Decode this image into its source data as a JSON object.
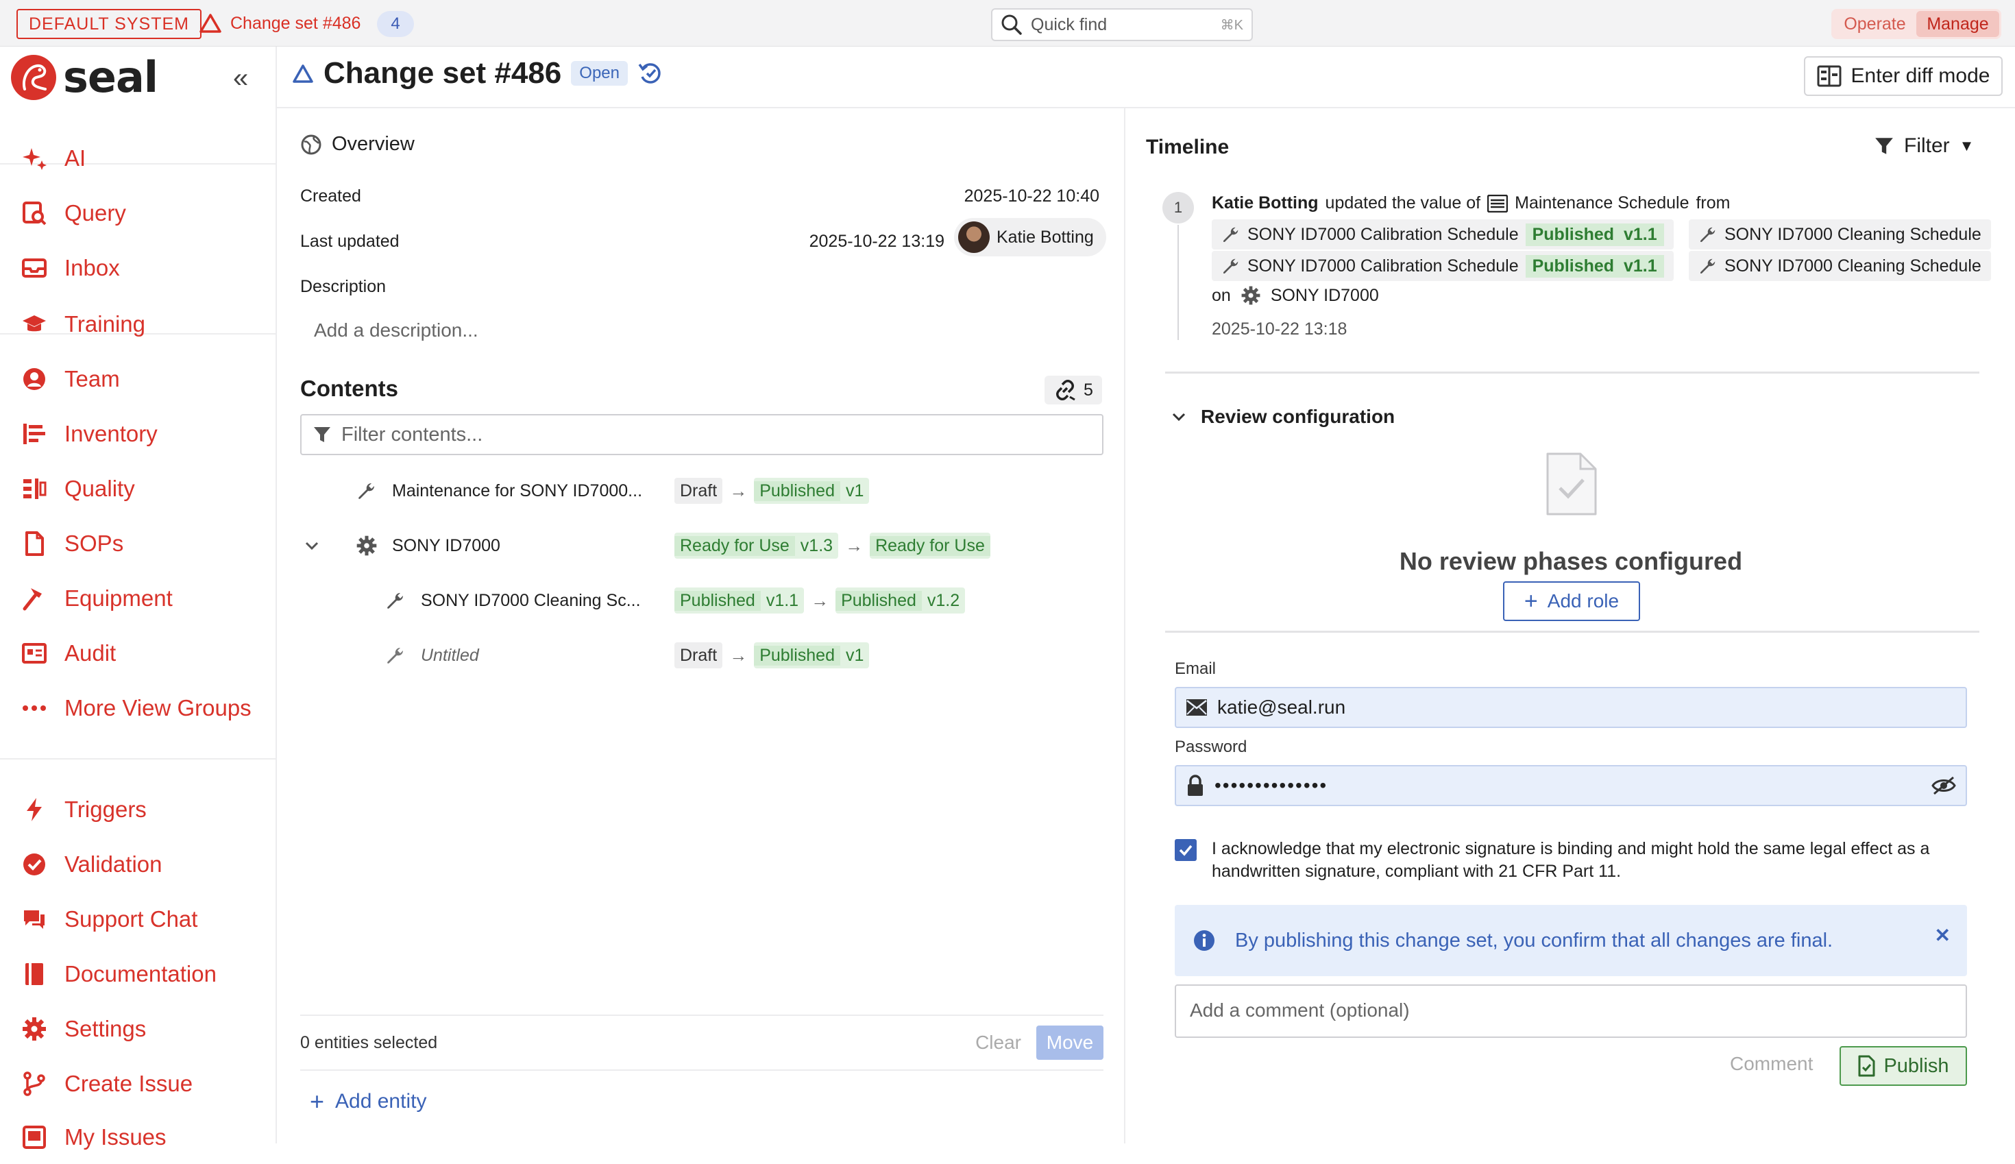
{
  "topbar": {
    "system_badge": "DEFAULT SYSTEM",
    "changeset_label": "Change set #486",
    "changeset_count": "4",
    "quick_find_placeholder": "Quick find",
    "quick_find_shortcut": "⌘K",
    "modes": [
      "Operate",
      "Manage"
    ],
    "active_mode": "Manage"
  },
  "sidebar": {
    "logo_text": "seal",
    "items": [
      {
        "label": "AI",
        "icon": "sparkles-icon"
      },
      {
        "label": "Query",
        "icon": "query-icon"
      },
      {
        "label": "Inbox",
        "icon": "inbox-icon"
      },
      {
        "label": "Training",
        "icon": "graduation-cap-icon"
      },
      {
        "label": "Team",
        "icon": "user-icon"
      },
      {
        "label": "Inventory",
        "icon": "inventory-icon"
      },
      {
        "label": "Quality",
        "icon": "quality-icon"
      },
      {
        "label": "SOPs",
        "icon": "document-icon"
      },
      {
        "label": "Equipment",
        "icon": "hammer-icon"
      },
      {
        "label": "Audit",
        "icon": "audit-icon"
      },
      {
        "label": "More View Groups",
        "icon": "more-icon"
      },
      {
        "label": "Triggers",
        "icon": "lightning-icon"
      },
      {
        "label": "Validation",
        "icon": "check-badge-icon"
      },
      {
        "label": "Support Chat",
        "icon": "chat-icon"
      },
      {
        "label": "Documentation",
        "icon": "book-icon"
      },
      {
        "label": "Settings",
        "icon": "gear-icon"
      },
      {
        "label": "Create Issue",
        "icon": "branch-icon"
      },
      {
        "label": "My Issues",
        "icon": "issues-icon"
      }
    ]
  },
  "header": {
    "title": "Change set #486",
    "status": "Open",
    "diff_button": "Enter diff mode"
  },
  "overview": {
    "heading": "Overview",
    "created_label": "Created",
    "created_value": "2025-10-22 10:40",
    "updated_label": "Last updated",
    "updated_value": "2025-10-22 13:19",
    "updated_by": "Katie Botting",
    "description_label": "Description",
    "description_placeholder": "Add a description..."
  },
  "contents": {
    "heading": "Contents",
    "link_count": "5",
    "filter_placeholder": "Filter contents...",
    "rows": [
      {
        "name": "Maintenance for SONY ID7000...",
        "from_status": "Draft",
        "from_version": "",
        "to_status": "Published",
        "to_version": "v1"
      },
      {
        "name": "SONY ID7000",
        "from_status": "Ready for Use",
        "from_version": "v1.3",
        "to_status": "Ready for Use",
        "to_version": ""
      },
      {
        "name": "SONY ID7000 Cleaning Sc...",
        "from_status": "Published",
        "from_version": "v1.1",
        "to_status": "Published",
        "to_version": "v1.2"
      },
      {
        "name": "Untitled",
        "from_status": "Draft",
        "from_version": "",
        "to_status": "Published",
        "to_version": "v1"
      }
    ],
    "selected_text": "0 entities selected",
    "clear_label": "Clear",
    "move_label": "Move",
    "add_entity_label": "Add entity"
  },
  "timeline": {
    "heading": "Timeline",
    "filter_label": "Filter",
    "entry": {
      "number": "1",
      "actor": "Katie Botting",
      "action": "updated the value of",
      "field": "Maintenance Schedule",
      "from_word": "from",
      "refs": [
        {
          "name": "SONY ID7000 Calibration Schedule",
          "status": "Published",
          "version": "v1.1"
        },
        {
          "name": "SONY ID7000 Cleaning Schedule"
        },
        {
          "name": "SONY ID7000 Calibration Schedule",
          "status": "Published",
          "version": "v1.1"
        },
        {
          "name": "SONY ID7000 Cleaning Schedule"
        }
      ],
      "on_word": "on",
      "on_target": "SONY ID7000",
      "timestamp": "2025-10-22 13:18"
    }
  },
  "review": {
    "heading": "Review configuration",
    "empty_text": "No review phases configured",
    "add_role_label": "Add role"
  },
  "signature": {
    "email_label": "Email",
    "email_value": "katie@seal.run",
    "password_label": "Password",
    "password_value": "••••••••••••••",
    "ack_text": "I acknowledge that my electronic signature is binding and might hold the same legal effect as a handwritten signature, compliant with 21 CFR Part 11.",
    "info_text": "By publishing this change set, you confirm that all changes are final.",
    "comment_placeholder": "Add a comment (optional)",
    "comment_button": "Comment",
    "publish_button": "Publish"
  },
  "colors": {
    "brand_red": "#d8322a",
    "link_blue": "#3a62b6",
    "published_green": "#2e7d32"
  }
}
